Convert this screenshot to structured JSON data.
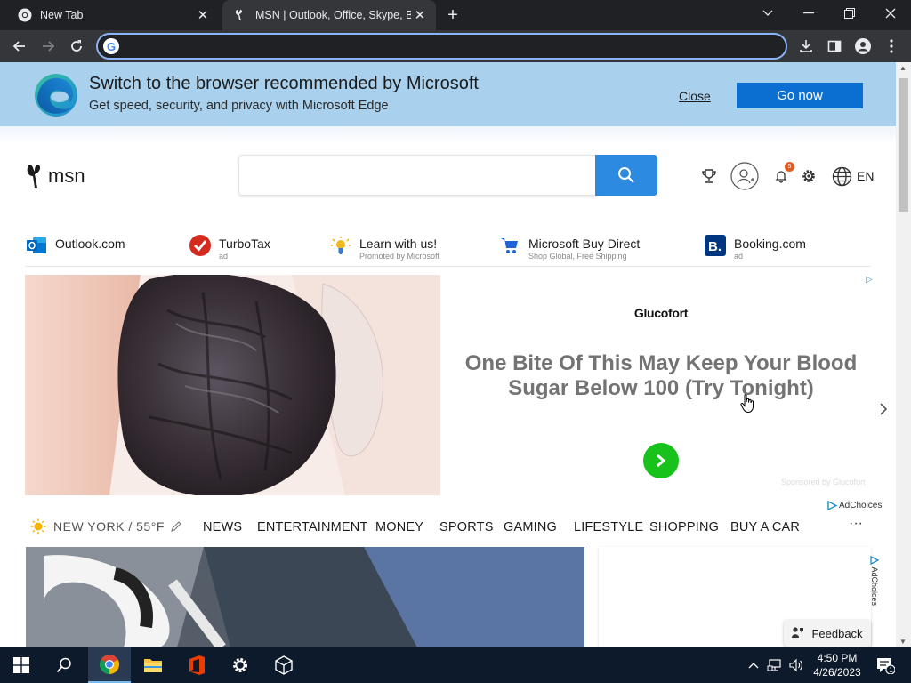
{
  "browser": {
    "tabs": [
      {
        "title": "New Tab",
        "active": false
      },
      {
        "title": "MSN | Outlook, Office, Skype, Bing, Breaking News, and Latest Videos",
        "active": true
      }
    ],
    "address_value": ""
  },
  "edge_banner": {
    "title": "Switch to the browser recommended by Microsoft",
    "subtitle": "Get speed, security, and privacy with Microsoft Edge",
    "close_label": "Close",
    "go_label": "Go now"
  },
  "msn": {
    "logo_text": "msn",
    "search_value": "",
    "notification_count": "5",
    "language": "EN"
  },
  "quick_links": [
    {
      "label": "Outlook.com",
      "sub": "",
      "icon": "outlook-icon"
    },
    {
      "label": "TurboTax",
      "sub": "ad",
      "icon": "turbotax-icon"
    },
    {
      "label": "Learn with us!",
      "sub": "Promoted by Microsoft",
      "icon": "lightbulb-icon"
    },
    {
      "label": "Microsoft Buy Direct",
      "sub": "Shop Global, Free Shipping",
      "icon": "cart-icon"
    },
    {
      "label": "Booking.com",
      "sub": "ad",
      "icon": "booking-icon"
    }
  ],
  "ad": {
    "brand": "Glucofort",
    "headline": "One Bite Of This May Keep Your Blood Sugar Below 100 (Try Tonight)",
    "sponsor": "Sponsored by Glucofort",
    "adchoices": "AdChoices"
  },
  "nav": {
    "weather": "NEW YORK / 55°F",
    "items": [
      "NEWS",
      "ENTERTAINMENT",
      "MONEY",
      "SPORTS",
      "GAMING",
      "LIFESTYLE",
      "SHOPPING",
      "BUY A CAR"
    ],
    "more": "···"
  },
  "side_ad": {
    "adchoices": "AdChoices"
  },
  "feedback_label": "Feedback",
  "taskbar": {
    "time": "4:50 PM",
    "date": "4/26/2023",
    "notifications": "1"
  },
  "colors": {
    "edge_banner_bg": "#a9d0ed",
    "go_button": "#0a6fd1",
    "search_button": "#2c8ae0",
    "ad_go_button": "#18c21b"
  }
}
